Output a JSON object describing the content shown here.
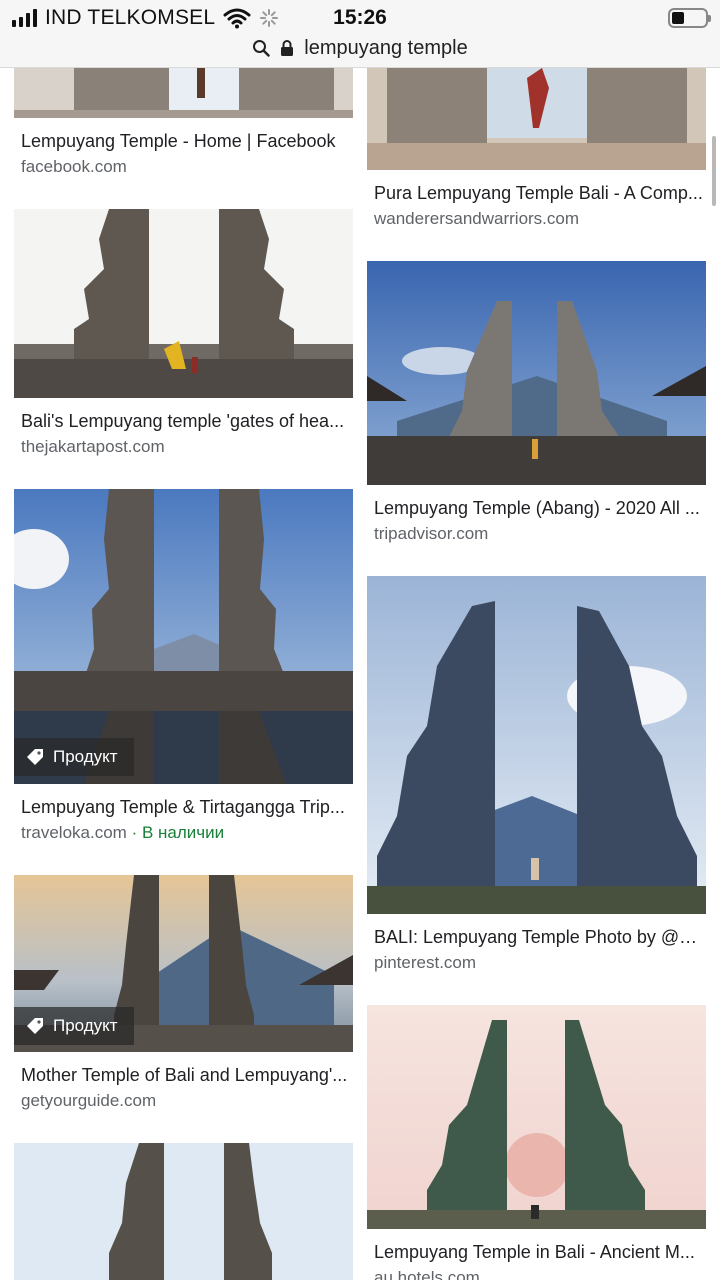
{
  "status_bar": {
    "carrier": "IND TELKOMSEL",
    "time": "15:26"
  },
  "url_bar": {
    "query": "lempuyang temple"
  },
  "colors": {
    "source_gray": "#5f6368",
    "in_stock_green": "#188038"
  },
  "results": [
    {
      "title": "Lempuyang Temple - Home | Facebook",
      "source": "facebook.com"
    },
    {
      "title": "Pura Lempuyang Temple Bali - A Comp...",
      "source": "wanderersandwarriors.com"
    },
    {
      "title": "Bali's Lempuyang temple 'gates of hea...",
      "source": "thejakartapost.com"
    },
    {
      "title": "Lempuyang Temple (Abang) - 2020 All ...",
      "source": "tripadvisor.com"
    },
    {
      "title": "Lempuyang Temple & Tirtagangga Trip...",
      "source": "traveloka.com",
      "availability": "· В наличии",
      "badge": "Продукт"
    },
    {
      "title": "BALI: Lempuyang Temple Photo by @a...",
      "source": "pinterest.com"
    },
    {
      "title": "Mother Temple of Bali and Lempuyang'...",
      "source": "getyourguide.com",
      "badge": "Продукт"
    },
    {
      "title": "Lempuyang Temple in Bali - Ancient M...",
      "source": "au.hotels.com"
    }
  ]
}
